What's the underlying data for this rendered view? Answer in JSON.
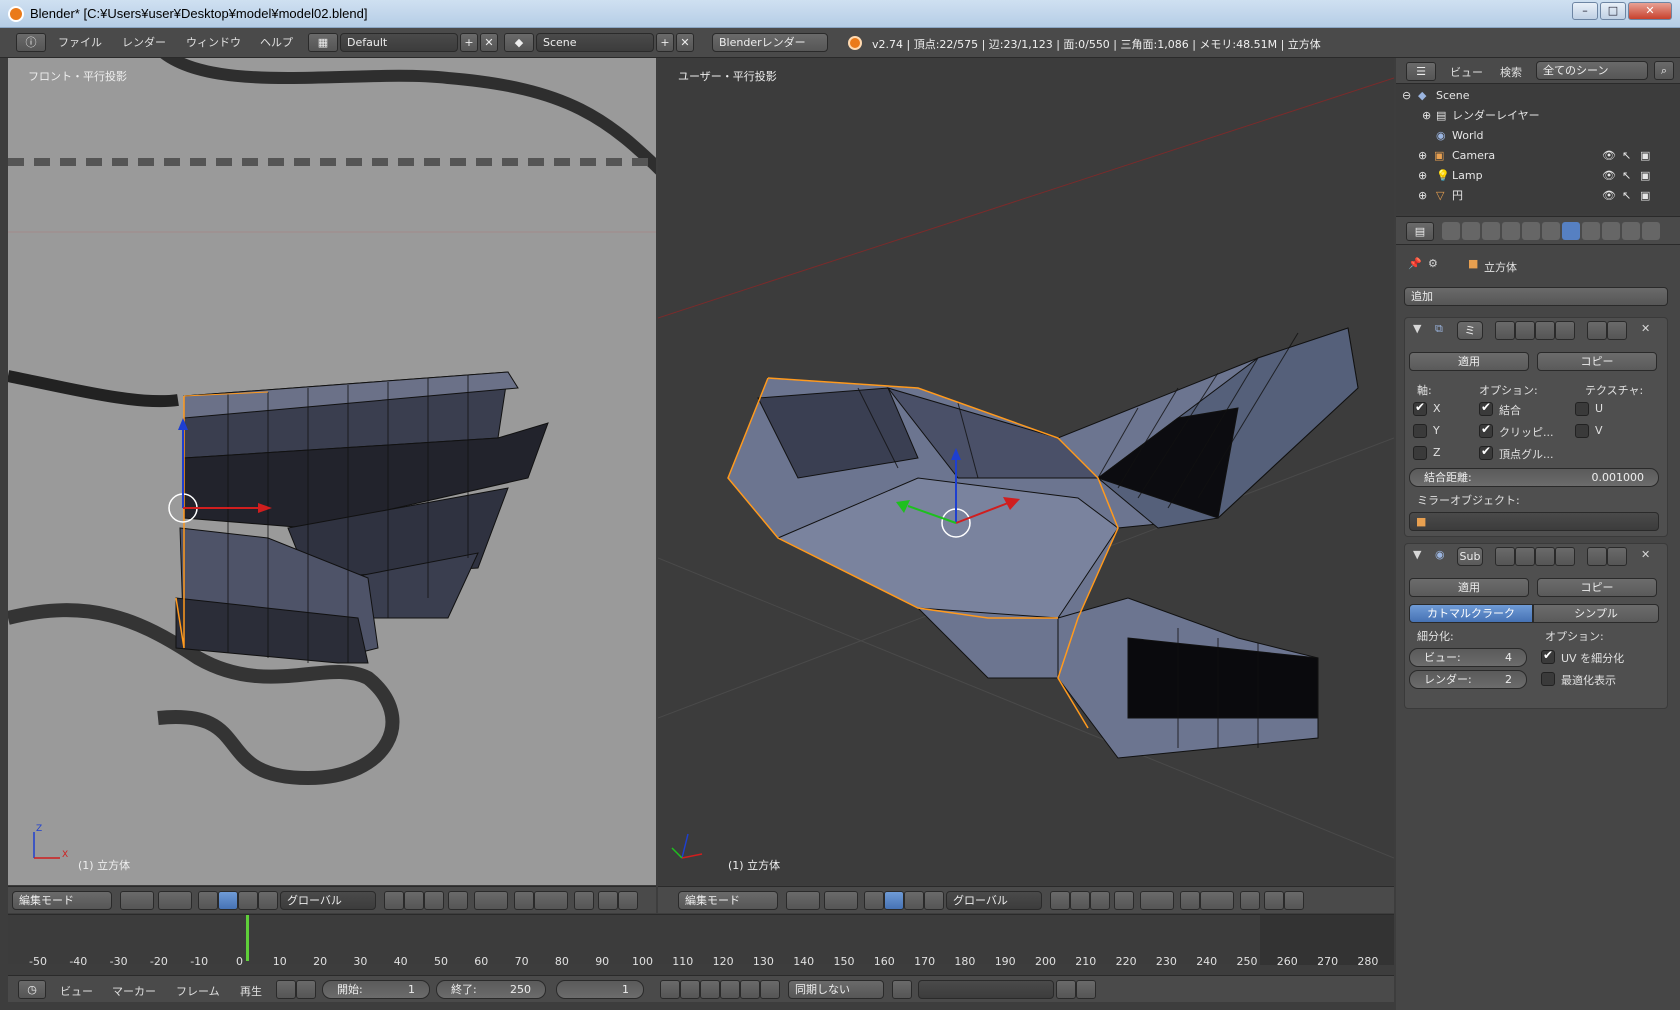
{
  "window": {
    "title": "Blender* [C:¥Users¥user¥Desktop¥model¥model02.blend]",
    "controls": [
      "–",
      "□",
      "✕"
    ]
  },
  "info_header": {
    "menus": [
      "ファイル",
      "レンダー",
      "ウィンドウ",
      "ヘルプ"
    ],
    "screen_layout": "Default",
    "scene": "Scene",
    "render_engine": "Blenderレンダー",
    "stats": "v2.74 | 頂点:22/575 | 辺:23/1,123 | 面:0/550 | 三角面:1,086 | メモリ:48.51M | 立方体"
  },
  "viewport_left": {
    "label": "フロント・平行投影",
    "object_label": "(1) 立方体",
    "axis_labels": {
      "z": "Z",
      "x": "X"
    },
    "mode": "編集モード",
    "orientation": "グローバル"
  },
  "viewport_right": {
    "label": "ユーザー・平行投影",
    "object_label": "(1) 立方体",
    "mode": "編集モード",
    "orientation": "グローバル"
  },
  "outliner": {
    "header": {
      "view": "ビュー",
      "search": "検索",
      "filter": "全てのシーン"
    },
    "items": [
      {
        "label": "Scene"
      },
      {
        "label": "レンダーレイヤー"
      },
      {
        "label": "World"
      },
      {
        "label": "Camera"
      },
      {
        "label": "Lamp"
      },
      {
        "label": "円"
      }
    ]
  },
  "properties": {
    "breadcrumb": "立方体",
    "add_modifier": "追加",
    "mirror": {
      "name": "ミ",
      "apply": "適用",
      "copy": "コピー",
      "axis_heading": "軸:",
      "options_heading": "オプション:",
      "texture_heading": "テクスチャ:",
      "axes": [
        {
          "label": "X",
          "checked": true
        },
        {
          "label": "Y",
          "checked": false
        },
        {
          "label": "Z",
          "checked": false
        }
      ],
      "options": [
        {
          "label": "結合",
          "checked": true
        },
        {
          "label": "クリッピ...",
          "checked": true
        },
        {
          "label": "頂点グル...",
          "checked": true
        }
      ],
      "textures": [
        {
          "label": "U",
          "checked": false
        },
        {
          "label": "V",
          "checked": false
        }
      ],
      "merge_distance_label": "結合距離:",
      "merge_distance_value": "0.001000",
      "mirror_object_label": "ミラーオブジェクト:"
    },
    "subsurf": {
      "name": "Sub",
      "apply": "適用",
      "copy": "コピー",
      "mode_catmull": "カトマルクラーク",
      "mode_simple": "シンプル",
      "subdiv_heading": "細分化:",
      "options_heading": "オプション:",
      "view_label": "ビュー:",
      "view_value": "4",
      "render_label": "レンダー:",
      "render_value": "2",
      "uv_label": "UV を細分化",
      "uv_checked": true,
      "optimal_label": "最適化表示",
      "optimal_checked": false
    }
  },
  "timeline": {
    "ticks": [
      "-50",
      "-40",
      "-30",
      "-20",
      "-10",
      "0",
      "10",
      "20",
      "30",
      "40",
      "50",
      "60",
      "70",
      "80",
      "90",
      "100",
      "110",
      "120",
      "130",
      "140",
      "150",
      "160",
      "170",
      "180",
      "190",
      "200",
      "210",
      "220",
      "230",
      "240",
      "250",
      "260",
      "270",
      "280"
    ],
    "menus": [
      "ビュー",
      "マーカー",
      "フレーム",
      "再生"
    ],
    "start_label": "開始:",
    "start_value": "1",
    "end_label": "終了:",
    "end_value": "250",
    "current_frame": "1",
    "sync": "同期しない"
  },
  "colors": {
    "accent_blue": "#5680c2",
    "selection_orange": "#ff9a1e",
    "viewport_bg": "#3c3c3c",
    "front_bg": "#9a9a9a"
  }
}
